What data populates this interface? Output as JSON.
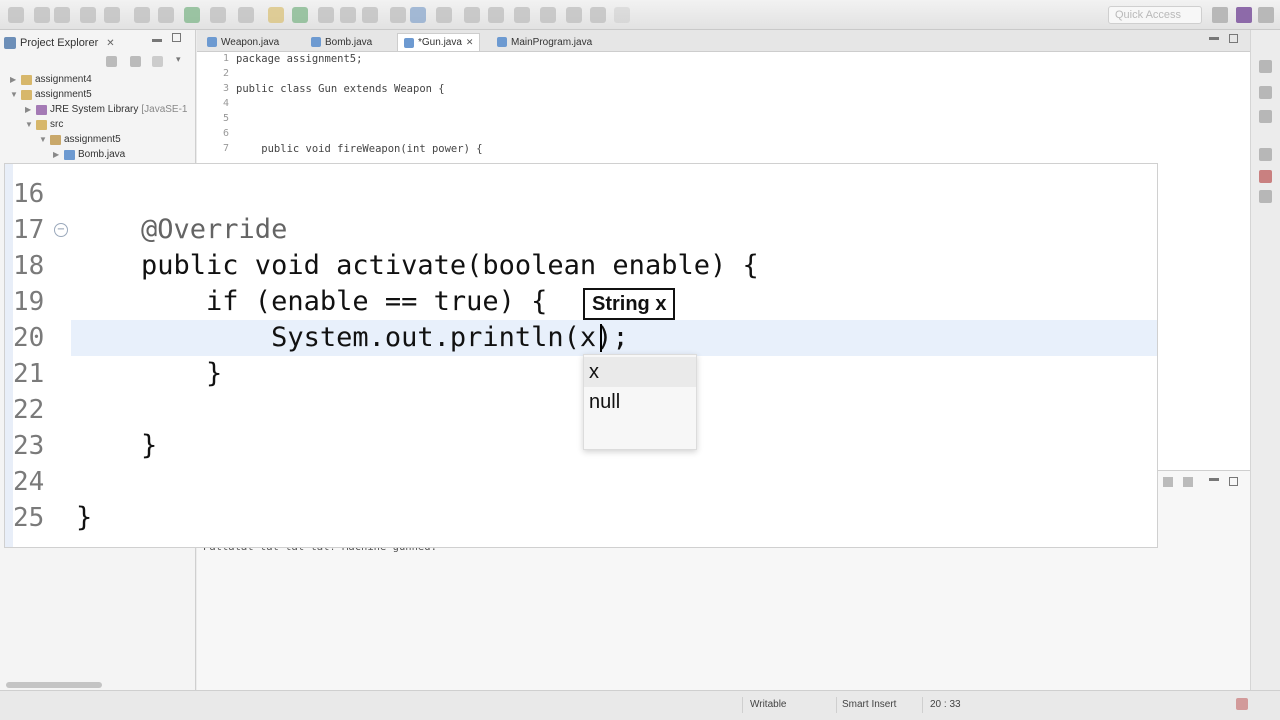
{
  "toolbar": {
    "quick_access_placeholder": "Quick Access"
  },
  "explorer": {
    "title": "Project Explorer",
    "items": [
      {
        "label": "assignment4",
        "extra": ""
      },
      {
        "label": "assignment5",
        "extra": ""
      },
      {
        "label": "JRE System Library",
        "extra": "[JavaSE-1"
      },
      {
        "label": "src",
        "extra": ""
      },
      {
        "label": "assignment5",
        "extra": ""
      },
      {
        "label": "Bomb.java",
        "extra": ""
      }
    ]
  },
  "editor": {
    "tabs": [
      {
        "label": "Weapon.java"
      },
      {
        "label": "Bomb.java"
      },
      {
        "label": "*Gun.java"
      },
      {
        "label": "MainProgram.java"
      }
    ],
    "background_lines": [
      {
        "num": "1",
        "text": "package assignment5;"
      },
      {
        "num": "2",
        "text": ""
      },
      {
        "num": "3",
        "text": "public class Gun extends Weapon {"
      },
      {
        "num": "4",
        "text": ""
      },
      {
        "num": "5",
        "text": ""
      },
      {
        "num": "6",
        "text": ""
      },
      {
        "num": "7",
        "text": "    public void fireWeapon(int power) {"
      }
    ]
  },
  "zoom": {
    "lines": [
      {
        "num": "16",
        "text": ""
      },
      {
        "num": "17",
        "text": "    @Override"
      },
      {
        "num": "18",
        "text": "    public void activate(boolean enable) {"
      },
      {
        "num": "19",
        "text": "        if (enable == true) {"
      },
      {
        "num": "20",
        "text": "            System.out.println(x);"
      },
      {
        "num": "21",
        "text": "        }"
      },
      {
        "num": "22",
        "text": ""
      },
      {
        "num": "23",
        "text": "    }"
      },
      {
        "num": "24",
        "text": ""
      },
      {
        "num": "25",
        "text": "}"
      }
    ],
    "param_hint": "String x",
    "completions": [
      "x",
      "null"
    ]
  },
  "console": {
    "output": "Pattatat tat tat tat!  Machine gunned."
  },
  "status": {
    "writable": "Writable",
    "insert_mode": "Smart Insert",
    "position": "20 : 33"
  }
}
